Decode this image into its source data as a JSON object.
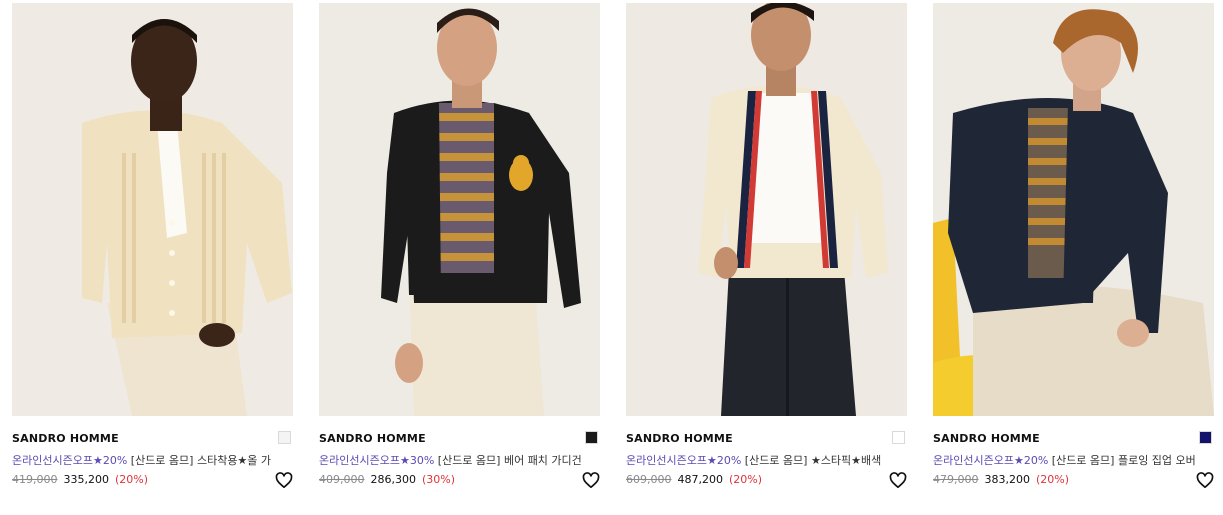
{
  "products": [
    {
      "brand": "SANDRO HOMME",
      "promo": "온라인선시즌오프★20%",
      "title": " [산드로 옴므] 스타착용★올 가",
      "original_price": "419,000",
      "sale_price": "335,200",
      "discount": "(20%)",
      "swatch_color": "#f4f4f4",
      "icon": "heart-icon"
    },
    {
      "brand": "SANDRO HOMME",
      "promo": "온라인선시즌오프★30%",
      "title": " [산드로 옴므] 베어 패치 가디건",
      "original_price": "409,000",
      "sale_price": "286,300",
      "discount": "(30%)",
      "swatch_color": "#1a1a1a",
      "icon": "heart-icon"
    },
    {
      "brand": "SANDRO HOMME",
      "promo": "온라인선시즌오프★20%",
      "title": " [산드로 옴므] ★스타픽★배색",
      "original_price": "609,000",
      "sale_price": "487,200",
      "discount": "(20%)",
      "swatch_color": "#ffffff",
      "icon": "heart-icon"
    },
    {
      "brand": "SANDRO HOMME",
      "promo": "온라인선시즌오프★20%",
      "title": " [산드로 옴므] 플로잉 집업 오버",
      "original_price": "479,000",
      "sale_price": "383,200",
      "discount": "(20%)",
      "swatch_color": "#13136b",
      "icon": "heart-icon"
    }
  ]
}
